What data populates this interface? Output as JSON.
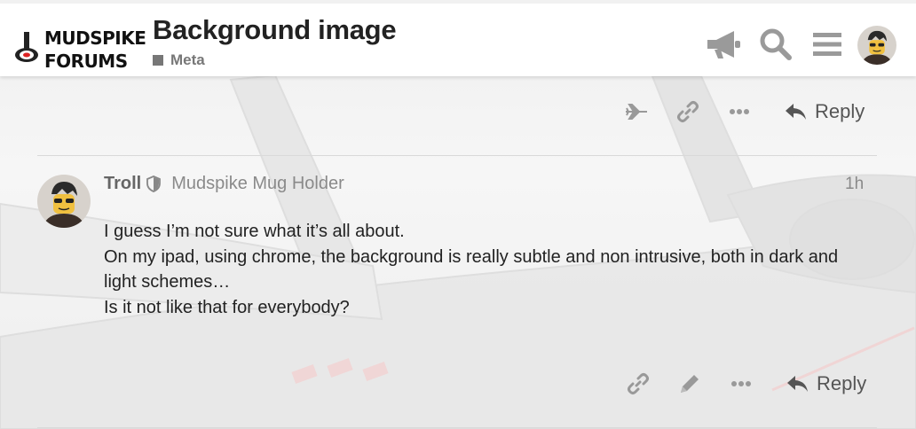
{
  "header": {
    "logo_line1": "MUDSPIKE",
    "logo_line2": "FORUMS",
    "topic_title": "Background image",
    "category": "Meta",
    "icons": [
      "megaphone-icon",
      "search-icon",
      "hamburger-menu-icon",
      "user-avatar"
    ]
  },
  "top_actions": {
    "icons": [
      "plane-icon",
      "link-icon",
      "more-icon"
    ],
    "reply_label": "Reply"
  },
  "post": {
    "username": "Troll",
    "user_title": "Mudspike Mug Holder",
    "date": "1h",
    "body": [
      "I guess I’m not sure what it’s all about.",
      "On my ipad, using chrome, the background is really subtle and non intrusive, both in dark and light schemes…",
      "Is it not like that for everybody?"
    ],
    "actions": {
      "icons": [
        "link-icon",
        "edit-icon",
        "more-icon"
      ],
      "reply_label": "Reply"
    }
  },
  "colors": {
    "text": "#222222",
    "muted": "#8a8a8a",
    "icon": "#999999",
    "header_bg": "#ffffff"
  }
}
